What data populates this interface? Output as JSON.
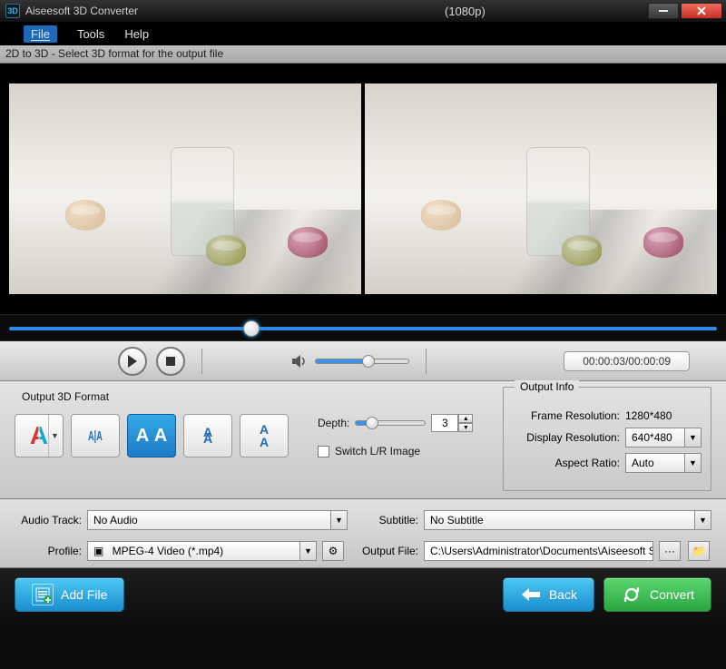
{
  "titlebar": {
    "app_name": "Aiseesoft 3D Converter",
    "resolution_suffix": "(1080p)"
  },
  "menu": {
    "file": "File",
    "tools": "Tools",
    "help": "Help"
  },
  "hint": "2D to 3D - Select 3D format for the output file",
  "playback": {
    "time_display": "00:00:03/00:00:09"
  },
  "format": {
    "section_label": "Output 3D Format",
    "depth_label": "Depth:",
    "depth_value": "3",
    "switch_label": "Switch L/R Image"
  },
  "output_info": {
    "legend": "Output Info",
    "frame_res_label": "Frame Resolution:",
    "frame_res_value": "1280*480",
    "display_res_label": "Display Resolution:",
    "display_res_value": "640*480",
    "aspect_label": "Aspect Ratio:",
    "aspect_value": "Auto"
  },
  "tracks": {
    "audio_label": "Audio Track:",
    "audio_value": "No Audio",
    "subtitle_label": "Subtitle:",
    "subtitle_value": "No Subtitle",
    "profile_label": "Profile:",
    "profile_value": "MPEG-4 Video (*.mp4)",
    "outfile_label": "Output File:",
    "outfile_value": "C:\\Users\\Administrator\\Documents\\Aiseesoft Stu"
  },
  "actions": {
    "add_file": "Add File",
    "back": "Back",
    "convert": "Convert"
  }
}
